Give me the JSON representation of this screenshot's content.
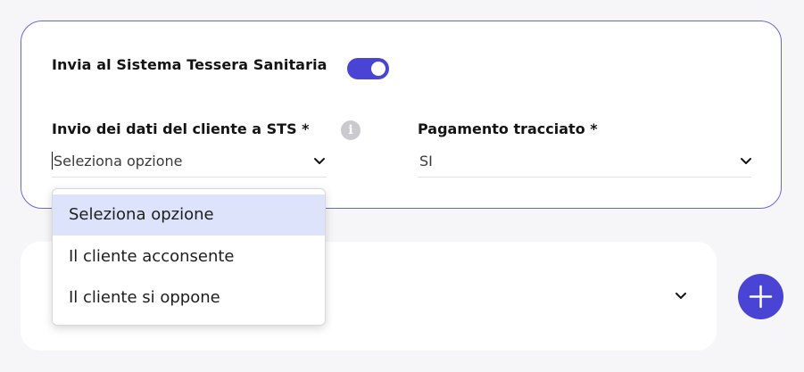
{
  "sts": {
    "label": "Invia al Sistema Tessera Sanitaria",
    "toggle_on": true
  },
  "client_data": {
    "label": "Invio dei dati del cliente a STS *",
    "value": "Seleziona opzione",
    "info_icon": "info-icon",
    "options": [
      "Seleziona opzione",
      "Il cliente acconsente",
      "Il cliente si oppone"
    ],
    "selected_index": 0
  },
  "payment": {
    "label": "Pagamento tracciato *",
    "value": "SI"
  },
  "icons": {
    "chevron": "chevron-down-icon",
    "add": "plus-icon"
  },
  "colors": {
    "accent": "#4a44d4",
    "card_border": "#6b65dc",
    "highlight": "#dde3fb"
  }
}
